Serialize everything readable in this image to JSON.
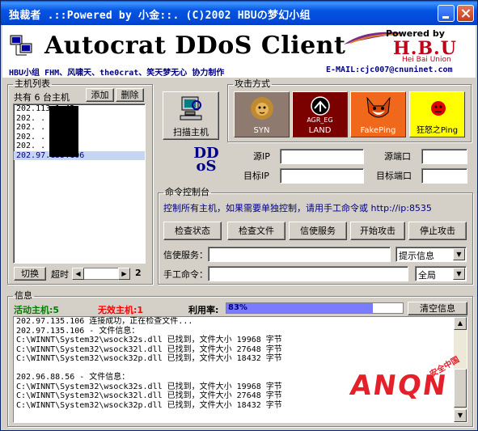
{
  "window": {
    "title": "独裁者 .::Powered by 小金::. (C)2002 HBUの梦幻小组"
  },
  "banner": {
    "app_name": "Autocrat DDoS Client",
    "credits": "HBU小组 FHM、风啸天、the0crat、笑天梦无心 协力制作",
    "email": "E-MAIL:cjc007@cnuninet.com",
    "powered": "Powered by",
    "hbu": "H.B.U",
    "hbu_sub": "Hei Bai Union"
  },
  "hosts": {
    "legend": "主机列表",
    "count_label": "共有 6 台主机",
    "add_label": "添加",
    "delete_label": "删除",
    "items": [
      "202.113.1.42",
      "202.  .  .67",
      "202.  .  .61",
      "202.  .  .2",
      "202.  .  .56",
      "202.97.135.106"
    ],
    "selected_index": 5,
    "switch_label": "切换",
    "timeout_label": "超时",
    "timeout_value": "2"
  },
  "scan": {
    "label": "扫描主机"
  },
  "attack": {
    "legend": "攻击方式",
    "modes": [
      {
        "name": "SYN",
        "bg": "#8e7a6e"
      },
      {
        "name": "LAND",
        "bg": "#7b0000",
        "logo_text": "AGR_EG"
      },
      {
        "name": "FakePing",
        "bg": "#f0681c"
      },
      {
        "name": "狂怒之Ping",
        "bg": "#ffff00"
      }
    ]
  },
  "ip": {
    "dd_logo": "DDoS",
    "source_ip_label": "源IP",
    "target_ip_label": "目标IP",
    "source_port_label": "源端口",
    "target_port_label": "目标端口",
    "source_ip": "",
    "target_ip": "",
    "source_port": "",
    "target_port": ""
  },
  "console": {
    "legend": "命令控制台",
    "hint": "控制所有主机，如果需要单独控制，请用手工命令或 http://ip:8535",
    "buttons": [
      "检查状态",
      "检查文件",
      "信使服务",
      "开始攻击",
      "停止攻击"
    ],
    "messenger_label": "信使服务：",
    "messenger_value": "",
    "messenger_option": "提示信息",
    "manual_label": "手工命令：",
    "manual_value": "",
    "manual_option": "全局"
  },
  "info": {
    "legend": "信息",
    "active_label": "活动主机:5",
    "inactive_label": "无效主机:1",
    "usage_label": "利用率:",
    "usage_value": "83%",
    "usage_percent": 83,
    "clear_label": "清空信息",
    "log": [
      "202.97.135.106 连接成功，正在检查文件...",
      "202.97.135.106 - 文件信息：",
      "C:\\WINNT\\System32\\wsock32s.dll 已找到，文件大小 19968 字节",
      "C:\\WINNT\\System32\\wsock32l.dll 已找到，文件大小 27648 字节",
      "C:\\WINNT\\System32\\wsock32p.dll 已找到，文件大小 18432 字节",
      "",
      "202.96.88.56 - 文件信息：",
      "C:\\WINNT\\System32\\wsock32s.dll 已找到，文件大小 19968 字节",
      "C:\\WINNT\\System32\\wsock32l.dll 已找到，文件大小 27648 字节",
      "C:\\WINNT\\System32\\wsock32p.dll 已找到，文件大小 18432 字节"
    ]
  },
  "watermark": {
    "big": "ANQN",
    "small": "安全中国"
  },
  "colors": {
    "title_bar": "#0554e3",
    "active_green": "#007f00",
    "inactive_red": "#ff0000",
    "usage_bar": "#7b7bff",
    "navy_text": "#00007f"
  }
}
